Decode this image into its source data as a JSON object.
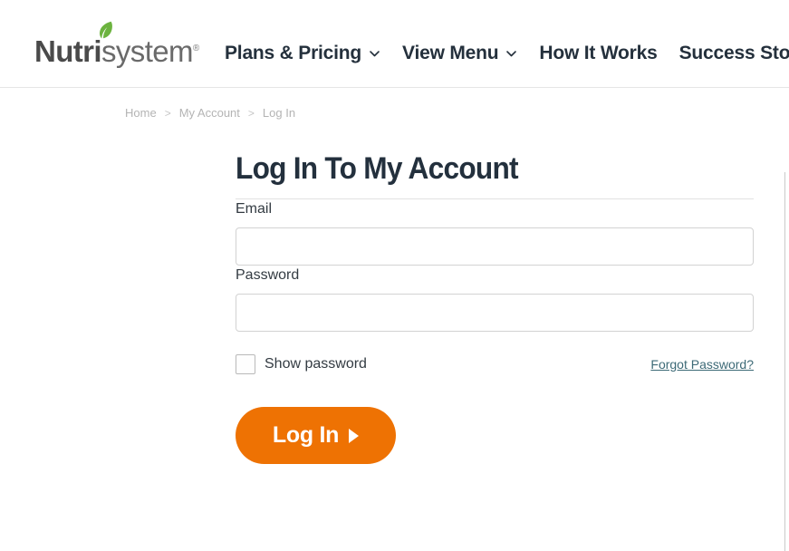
{
  "header": {
    "brand": {
      "name_part1": "Nutri",
      "name_part2": "system",
      "registered_mark": "®",
      "leaf_icon": "leaf-icon",
      "leaf_color": "#6cb33f"
    },
    "nav": [
      {
        "label": "Plans & Pricing",
        "has_dropdown": true,
        "icon": "chevron-down-icon"
      },
      {
        "label": "View Menu",
        "has_dropdown": true,
        "icon": "chevron-down-icon"
      },
      {
        "label": "How It Works",
        "has_dropdown": false
      },
      {
        "label": "Success Stories",
        "has_dropdown": false
      }
    ]
  },
  "breadcrumb": {
    "items": [
      {
        "label": "Home",
        "current": false
      },
      {
        "label": "My Account",
        "current": false
      },
      {
        "label": "Log In",
        "current": true
      }
    ],
    "separator": ">"
  },
  "main": {
    "title": "Log In To My Account",
    "fields": {
      "email": {
        "label": "Email",
        "value": "",
        "placeholder": ""
      },
      "password": {
        "label": "Password",
        "value": "",
        "placeholder": ""
      }
    },
    "show_password": {
      "label": "Show password",
      "checked": false
    },
    "forgot_password": {
      "label": "Forgot Password?"
    },
    "submit": {
      "label": "Log In",
      "arrow": "▶"
    }
  },
  "colors": {
    "accent_orange": "#ee7203",
    "title_navy": "#23303d",
    "link_teal": "#3d6a77",
    "breadcrumb_grey": "#b4b4b4",
    "border_grey": "#d2d2d2"
  }
}
